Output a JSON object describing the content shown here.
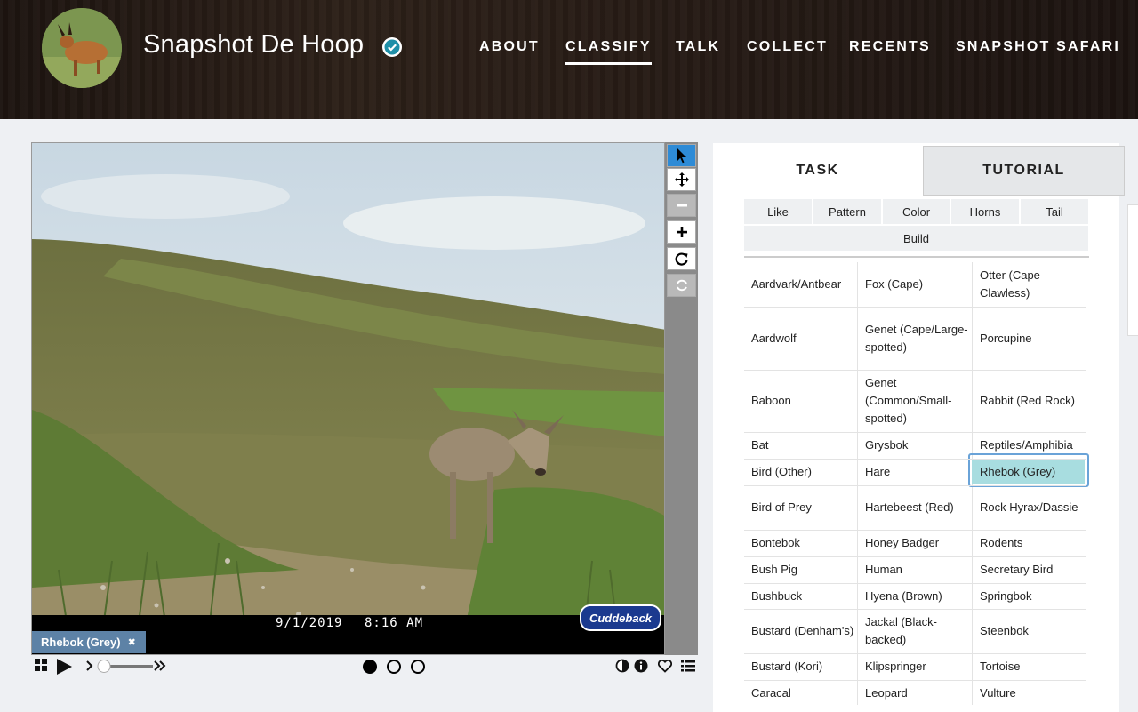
{
  "header": {
    "project_title": "Snapshot De Hoop",
    "nav": [
      {
        "label": "ABOUT",
        "active": false
      },
      {
        "label": "CLASSIFY",
        "active": true
      },
      {
        "label": "TALK",
        "active": false
      },
      {
        "label": "COLLECT",
        "active": false
      },
      {
        "label": "RECENTS",
        "active": false
      },
      {
        "label": "SNAPSHOT SAFARI",
        "active": false
      }
    ]
  },
  "viewer": {
    "date": "9/1/2019",
    "time": "8:16 AM",
    "camera_brand": "Cuddeback",
    "selected_tag": "Rhebok (Grey)",
    "tools": [
      "pointer-icon",
      "move-icon",
      "zoom-out-icon",
      "zoom-in-icon",
      "rotate-icon",
      "reset-icon"
    ]
  },
  "panel": {
    "tabs": [
      "TASK",
      "TUTORIAL"
    ],
    "filters": [
      "Like",
      "Pattern",
      "Color",
      "Horns",
      "Tail",
      "Build"
    ],
    "species": [
      [
        "Aardvark/Antbear",
        "Fox (Cape)",
        "Otter (Cape Clawless)"
      ],
      [
        "Aardwolf",
        "Genet (Cape/Large-spotted)",
        "Porcupine"
      ],
      [
        "Baboon",
        "Genet (Common/Small-spotted)",
        "Rabbit (Red Rock)"
      ],
      [
        "Bat",
        "Grysbok",
        "Reptiles/Amphibia"
      ],
      [
        "Bird (Other)",
        "Hare",
        "Rhebok (Grey)"
      ],
      [
        "Bird of Prey",
        "Hartebeest (Red)",
        "Rock Hyrax/Dassie"
      ],
      [
        "Bontebok",
        "Honey Badger",
        "Rodents"
      ],
      [
        "Bush Pig",
        "Human",
        "Secretary Bird"
      ],
      [
        "Bushbuck",
        "Hyena (Brown)",
        "Springbok"
      ],
      [
        "Bustard (Denham's)",
        "Jackal (Black-backed)",
        "Steenbok"
      ],
      [
        "Bustard (Kori)",
        "Klipspringer",
        "Tortoise"
      ],
      [
        "Caracal",
        "Leopard",
        "Vulture"
      ]
    ],
    "selected_species": "Rhebok (Grey)"
  },
  "colors": {
    "accent": "#2e8bd6",
    "selected_fill": "#a8dde0",
    "verified_badge": "#1f8fa8"
  }
}
